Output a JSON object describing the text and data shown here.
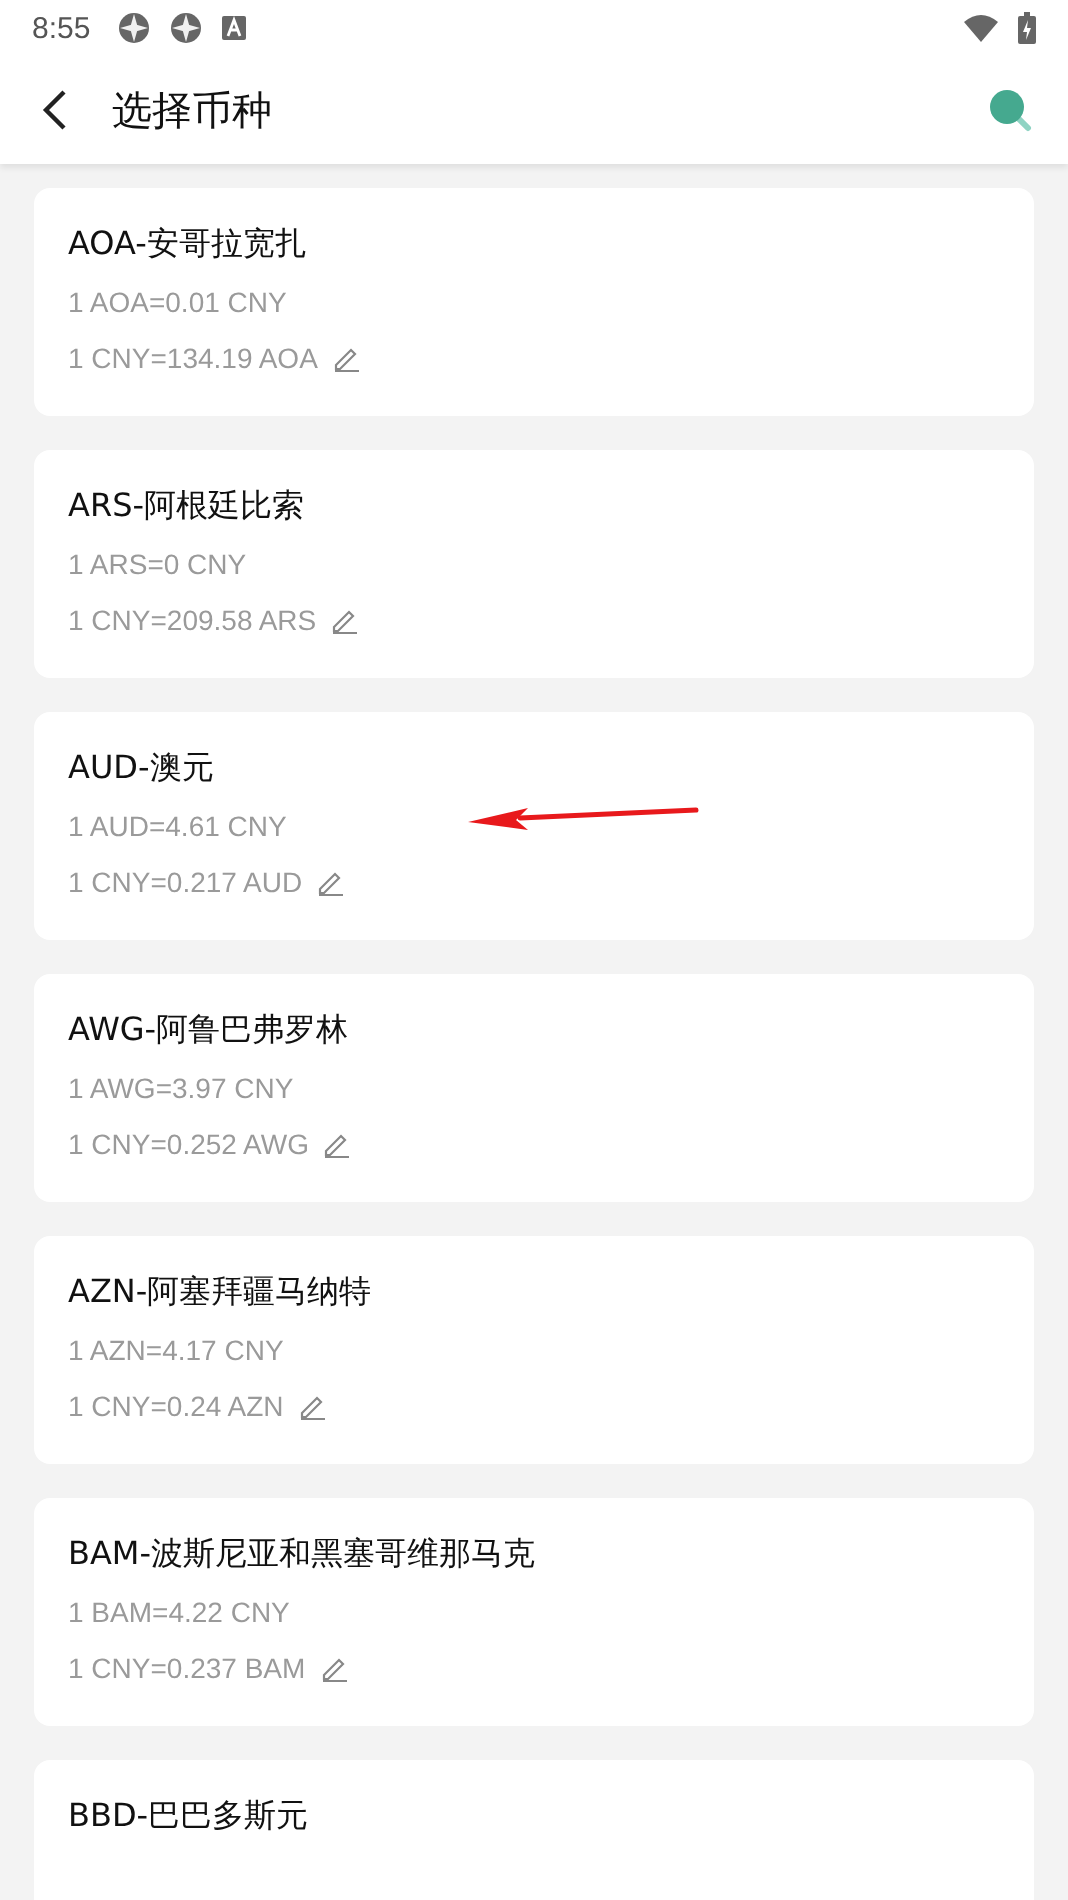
{
  "status_bar": {
    "time": "8:55"
  },
  "header": {
    "title": "选择币种"
  },
  "currencies": [
    {
      "name": "AOA-安哥拉宽扎",
      "rate": "1 AOA=0.01 CNY",
      "inverse": "1 CNY=134.19 AOA"
    },
    {
      "name": "ARS-阿根廷比索",
      "rate": "1 ARS=0 CNY",
      "inverse": "1 CNY=209.58 ARS"
    },
    {
      "name": "AUD-澳元",
      "rate": "1 AUD=4.61 CNY",
      "inverse": "1 CNY=0.217 AUD"
    },
    {
      "name": "AWG-阿鲁巴弗罗林",
      "rate": "1 AWG=3.97 CNY",
      "inverse": "1 CNY=0.252 AWG"
    },
    {
      "name": "AZN-阿塞拜疆马纳特",
      "rate": "1 AZN=4.17 CNY",
      "inverse": "1 CNY=0.24 AZN"
    },
    {
      "name": "BAM-波斯尼亚和黑塞哥维那马克",
      "rate": "1 BAM=4.22 CNY",
      "inverse": "1 CNY=0.237 BAM"
    },
    {
      "name": "BBD-巴巴多斯元"
    }
  ]
}
